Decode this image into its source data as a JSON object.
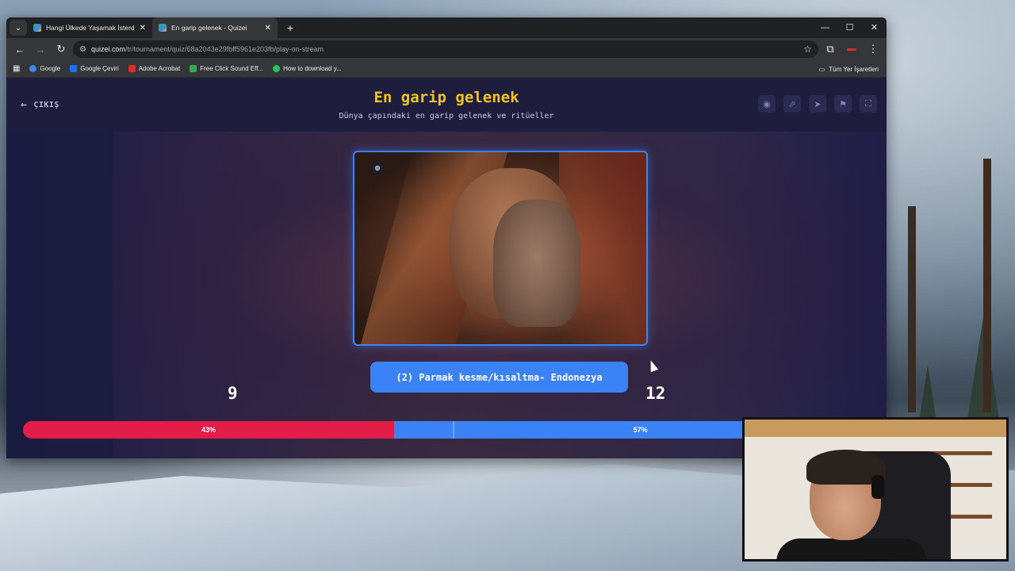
{
  "browser": {
    "tabs": [
      {
        "title": "Hangi Ülkede Yaşamak İsterdin",
        "active": false
      },
      {
        "title": "En garip gelenek - Quizei",
        "active": true
      }
    ],
    "url_host": "quizei.com",
    "url_path": "/tr/tournament/quiz/68a2043e29fbff5961e203fb/play-on-stream",
    "bookmarks": [
      {
        "label": "Google",
        "color": "#4285f4"
      },
      {
        "label": "Google Çeviri",
        "color": "#1a73e8"
      },
      {
        "label": "Adobe Acrobat",
        "color": "#d93025"
      },
      {
        "label": "Free Click Sound Eff...",
        "color": "#34a853"
      },
      {
        "label": "How to download y...",
        "color": "#22c55e"
      }
    ],
    "all_bookmarks": "Tüm Yer İşaretleri"
  },
  "quiz": {
    "exit_label": "ÇIKIŞ",
    "title": "En garip gelenek",
    "subtitle": "Dünya çapındaki en garip gelenek ve ritüeller",
    "answer": "(2) Parmak kesme/kısaltma- Endonezya",
    "score_left": "9",
    "score_right": "12",
    "percent_left_label": "43%",
    "percent_right_label": "57%",
    "percent_left": 43,
    "percent_right": 57
  },
  "colors": {
    "title": "#f5c518",
    "accent_blue": "#3b82f6",
    "accent_red": "#e11d48",
    "page_bg": "#1f1f3d"
  }
}
